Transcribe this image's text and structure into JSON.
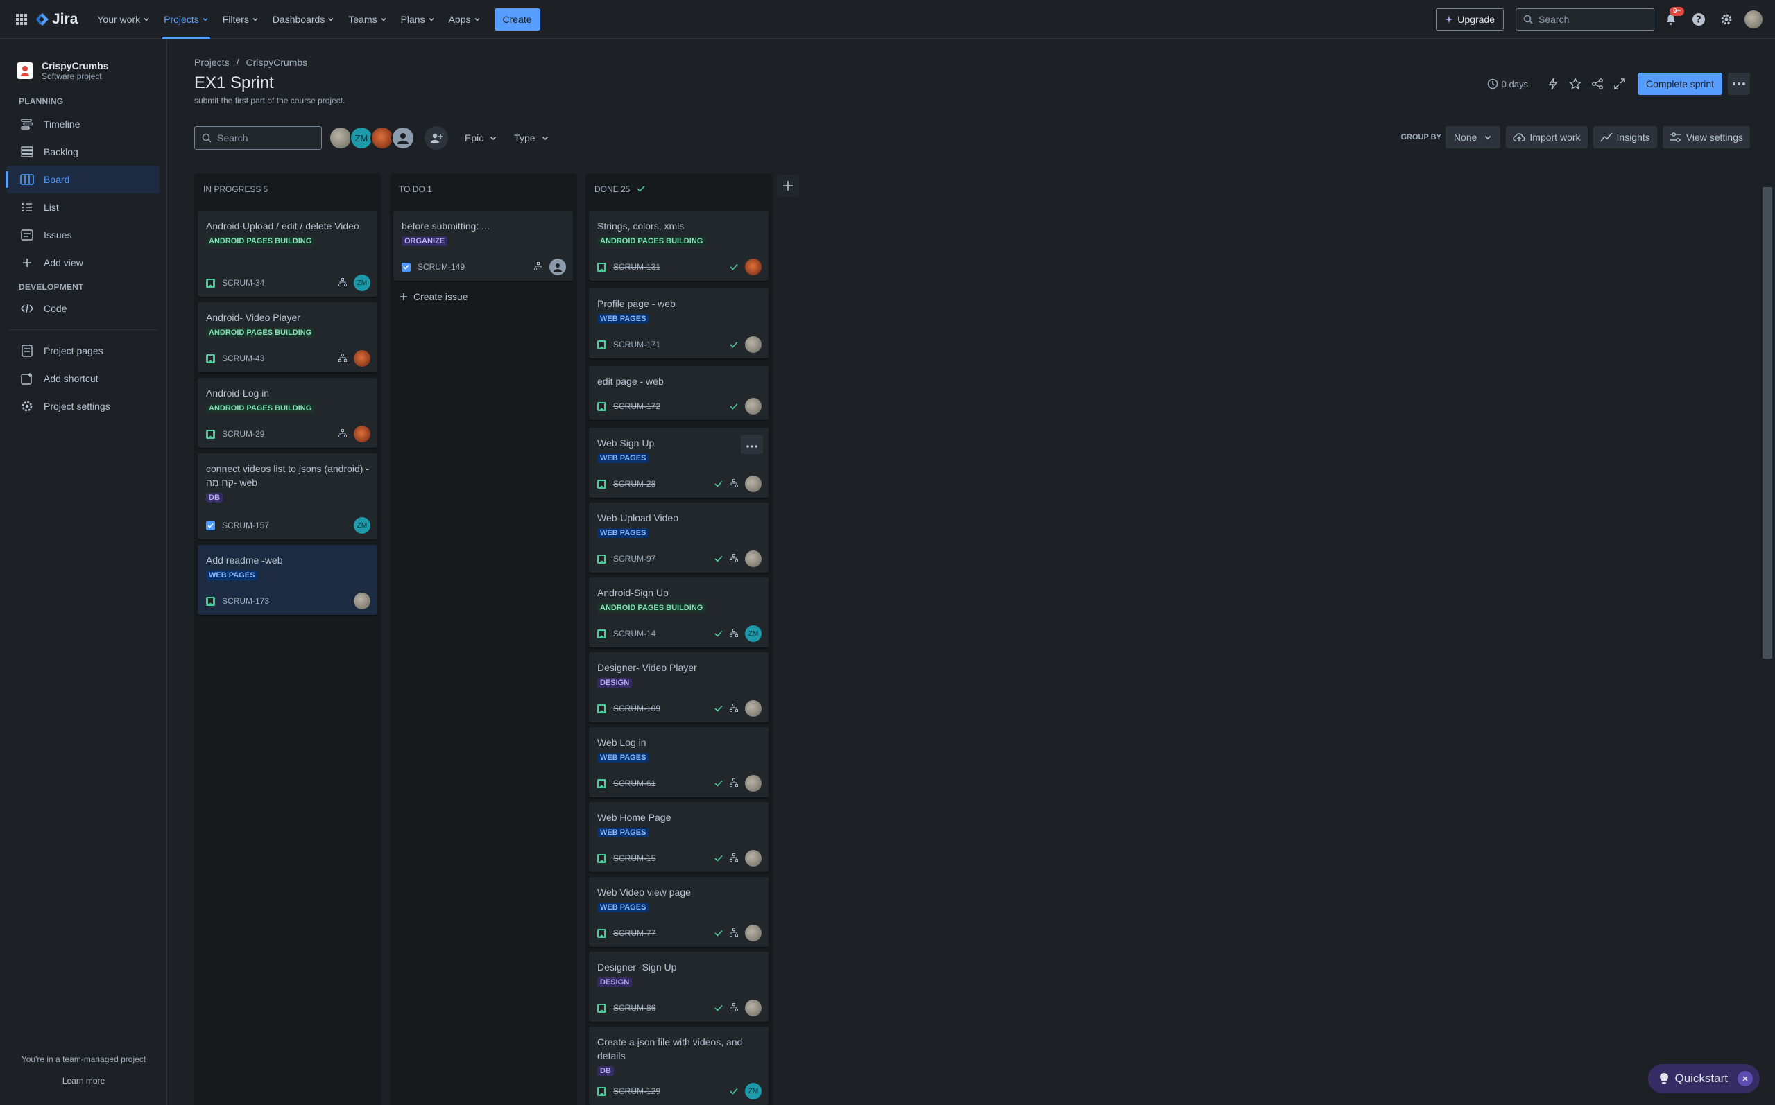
{
  "topnav": {
    "logo_text": "Jira",
    "items": [
      {
        "label": "Your work"
      },
      {
        "label": "Projects"
      },
      {
        "label": "Filters"
      },
      {
        "label": "Dashboards"
      },
      {
        "label": "Teams"
      },
      {
        "label": "Plans"
      },
      {
        "label": "Apps"
      }
    ],
    "create_label": "Create",
    "upgrade_label": "Upgrade",
    "search_placeholder": "Search",
    "notification_count": "9+"
  },
  "sidebar": {
    "project_name": "CrispyCrumbs",
    "project_type": "Software project",
    "planning_heading": "PLANNING",
    "planning_items": [
      {
        "label": "Timeline",
        "icon": "timeline-icon"
      },
      {
        "label": "Backlog",
        "icon": "backlog-icon"
      },
      {
        "label": "Board",
        "icon": "board-icon"
      },
      {
        "label": "List",
        "icon": "list-icon"
      },
      {
        "label": "Issues",
        "icon": "issues-icon"
      }
    ],
    "add_view_label": "Add view",
    "development_heading": "DEVELOPMENT",
    "code_label": "Code",
    "project_pages_label": "Project pages",
    "add_shortcut_label": "Add shortcut",
    "project_settings_label": "Project settings",
    "footer_text": "You're in a team-managed project",
    "learn_more_label": "Learn more"
  },
  "header": {
    "breadcrumb": [
      "Projects",
      "CrispyCrumbs"
    ],
    "title": "EX1 Sprint",
    "subtitle": "submit the first part of the course project.",
    "days_remaining": "0 days",
    "complete_label": "Complete sprint"
  },
  "toolbar": {
    "search_placeholder": "Search",
    "avatar_zm": "ZM",
    "epic_label": "Epic",
    "type_label": "Type",
    "group_by_label": "GROUP BY",
    "group_by_value": "None",
    "import_label": "Import work",
    "insights_label": "Insights",
    "view_settings_label": "View settings"
  },
  "columns": {
    "in_progress": {
      "title": "IN PROGRESS 5",
      "cards": [
        {
          "title": "Android-Upload / edit / delete Video",
          "epic": "ANDROID PAGES BUILDING",
          "key": "SCRUM-34",
          "assignee": "ZM"
        },
        {
          "title": "Android- Video Player",
          "epic": "ANDROID PAGES BUILDING",
          "key": "SCRUM-43"
        },
        {
          "title": "Android-Log in",
          "epic": "ANDROID PAGES BUILDING",
          "key": "SCRUM-29"
        },
        {
          "title": "connect videos list to jsons (android) - קח מה- web",
          "epic": "DB",
          "key": "SCRUM-157",
          "assignee": "ZM"
        },
        {
          "title": "Add readme -web",
          "epic": "WEB PAGES",
          "key": "SCRUM-173"
        }
      ]
    },
    "todo": {
      "title": "TO DO 1",
      "cards": [
        {
          "title": "before submitting: ...",
          "epic": "ORGANIZE",
          "key": "SCRUM-149"
        }
      ],
      "create_issue_label": "Create issue"
    },
    "done": {
      "title": "DONE 25",
      "cards": [
        {
          "title": "Strings, colors, xmls",
          "epic": "ANDROID PAGES BUILDING",
          "key": "SCRUM-131"
        },
        {
          "title": "Profile page - web",
          "epic": "WEB PAGES",
          "key": "SCRUM-171"
        },
        {
          "title": "edit page - web",
          "epic": "",
          "key": "SCRUM-172"
        },
        {
          "title": "Web Sign Up",
          "epic": "WEB PAGES",
          "key": "SCRUM-28"
        },
        {
          "title": "Web-Upload Video",
          "epic": "WEB PAGES",
          "key": "SCRUM-97"
        },
        {
          "title": "Android-Sign Up",
          "epic": "ANDROID PAGES BUILDING",
          "key": "SCRUM-14",
          "assignee": "ZM"
        },
        {
          "title": "Designer- Video Player",
          "epic": "DESIGN",
          "key": "SCRUM-109"
        },
        {
          "title": "Web Log in",
          "epic": "WEB PAGES",
          "key": "SCRUM-61"
        },
        {
          "title": "Web Home Page",
          "epic": "WEB PAGES",
          "key": "SCRUM-15"
        },
        {
          "title": "Web Video view page",
          "epic": "WEB PAGES",
          "key": "SCRUM-77"
        },
        {
          "title": "Designer -Sign Up",
          "epic": "DESIGN",
          "key": "SCRUM-86"
        },
        {
          "title": "Create a json file with videos, and details",
          "epic": "DB",
          "key": "SCRUM-129",
          "assignee": "ZM"
        }
      ]
    }
  },
  "quickstart_label": "Quickstart",
  "colors": {
    "accent": "#579dff",
    "background": "#1d2125",
    "column": "#161a1d",
    "card": "#22272b"
  }
}
